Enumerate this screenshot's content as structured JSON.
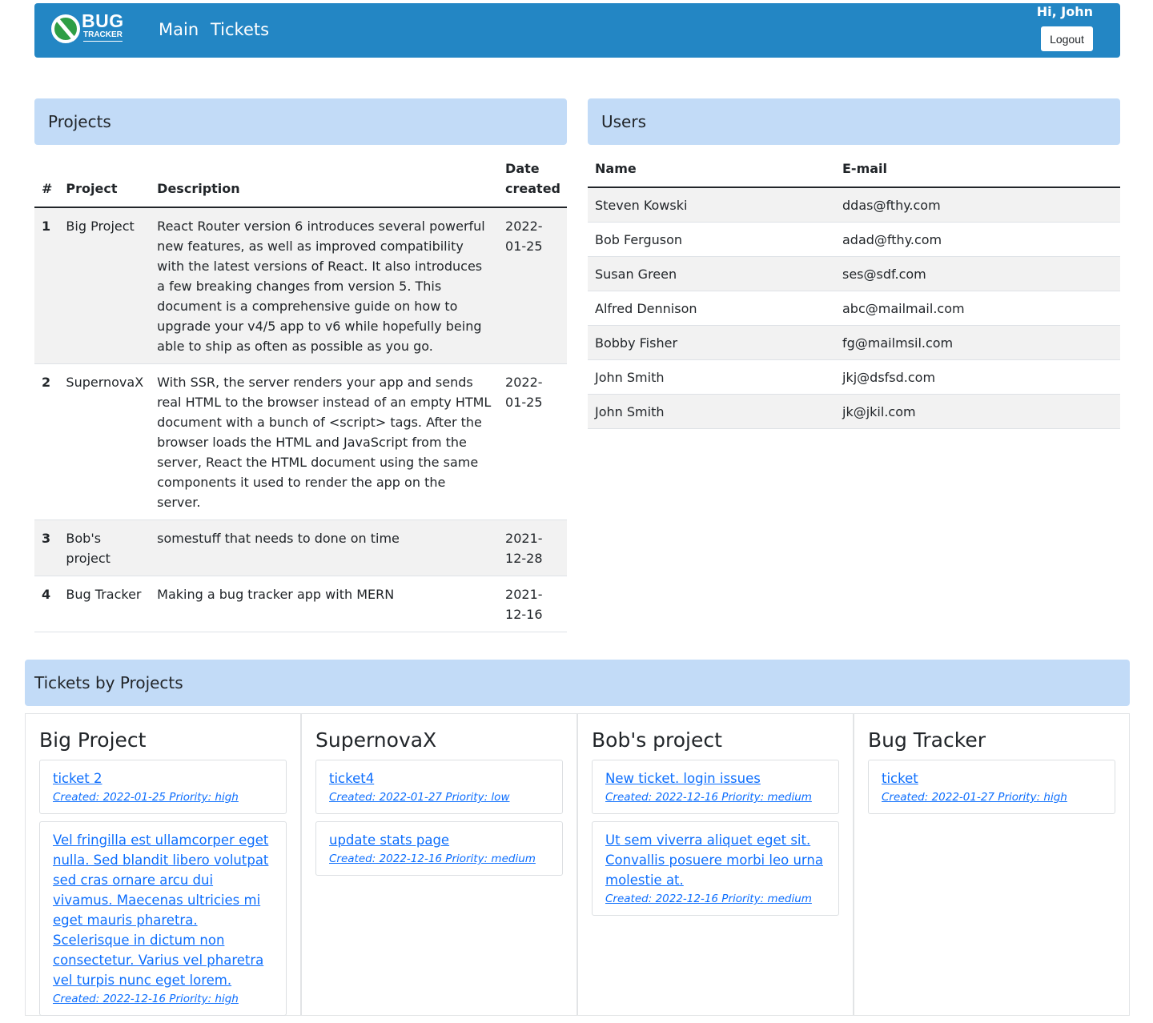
{
  "header": {
    "logo_text_top": "BUG",
    "logo_text_bottom": "TRACKER",
    "nav": [
      {
        "label": "Main"
      },
      {
        "label": "Tickets"
      }
    ],
    "greeting": "Hi, John",
    "logout_label": "Logout",
    "bg_color": "#2386c4"
  },
  "projects": {
    "title": "Projects",
    "columns": [
      "#",
      "Project",
      "Description",
      "Date created"
    ],
    "rows": [
      {
        "num": "1",
        "name": "Big Project",
        "description": "React Router version 6 introduces several powerful new features, as well as improved compatibility with the latest versions of React. It also introduces a few breaking changes from version 5. This document is a comprehensive guide on how to upgrade your v4/5 app to v6 while hopefully being able to ship as often as possible as you go.",
        "date": "2022-01-25"
      },
      {
        "num": "2",
        "name": "SupernovaX",
        "description": "With SSR, the server renders your app and sends real HTML to the browser instead of an empty HTML document with a bunch of <script> tags. After the browser loads the HTML and JavaScript from the server, React the HTML document using the same components it used to render the app on the server.",
        "date": "2022-01-25"
      },
      {
        "num": "3",
        "name": "Bob's project",
        "description": "somestuff that needs to done on time",
        "date": "2021-12-28"
      },
      {
        "num": "4",
        "name": "Bug Tracker",
        "description": "Making a bug tracker app with MERN",
        "date": "2021-12-16"
      }
    ]
  },
  "users": {
    "title": "Users",
    "columns": [
      "Name",
      "E-mail"
    ],
    "rows": [
      {
        "name": "Steven Kowski",
        "email": "ddas@fthy.com"
      },
      {
        "name": "Bob Ferguson",
        "email": "adad@fthy.com"
      },
      {
        "name": "Susan Green",
        "email": "ses@sdf.com"
      },
      {
        "name": "Alfred Dennison",
        "email": "abc@mailmail.com"
      },
      {
        "name": "Bobby Fisher",
        "email": "fg@mailmsil.com"
      },
      {
        "name": "John Smith",
        "email": "jkj@dsfsd.com"
      },
      {
        "name": "John Smith",
        "email": "jk@jkil.com"
      }
    ]
  },
  "tickets_by_projects": {
    "title": "Tickets by Projects",
    "groups": [
      {
        "project": "Big Project",
        "tickets": [
          {
            "title": "ticket 2",
            "meta": "Created: 2022-01-25 Priority: high"
          },
          {
            "title": "Vel fringilla est ullamcorper eget nulla. Sed blandit libero volutpat sed cras ornare arcu dui vivamus. Maecenas ultricies mi eget mauris pharetra. Scelerisque in dictum non consectetur. Varius vel pharetra vel turpis nunc eget lorem.",
            "meta": "Created: 2022-12-16 Priority: high"
          }
        ]
      },
      {
        "project": "SupernovaX",
        "tickets": [
          {
            "title": "ticket4",
            "meta": "Created: 2022-01-27 Priority: low"
          },
          {
            "title": "update stats page",
            "meta": "Created: 2022-12-16 Priority: medium"
          }
        ]
      },
      {
        "project": "Bob's project",
        "tickets": [
          {
            "title": "New ticket. login issues",
            "meta": "Created: 2022-12-16 Priority: medium"
          },
          {
            "title": "Ut sem viverra aliquet eget sit. Convallis posuere morbi leo urna molestie at.",
            "meta": "Created: 2022-12-16 Priority: medium"
          }
        ]
      },
      {
        "project": "Bug Tracker",
        "tickets": [
          {
            "title": "ticket",
            "meta": "Created: 2022-01-27 Priority: high"
          }
        ]
      }
    ]
  },
  "colors": {
    "section_header_bg": "#c2dbf7",
    "link": "#0d6efd",
    "stripe": "#f2f2f2"
  }
}
